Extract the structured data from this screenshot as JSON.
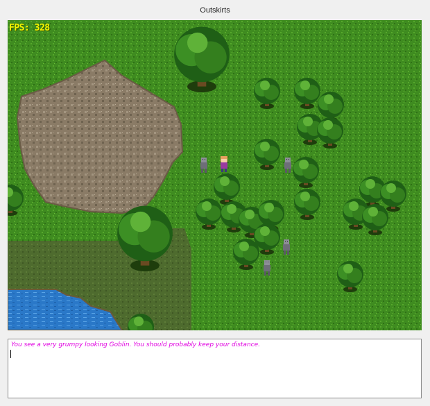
{
  "window": {
    "title": "Outskirts"
  },
  "hud": {
    "fps_label": "FPS: 328"
  },
  "message_log": {
    "lines": [
      "You see a very grumpy looking Goblin.  You should probably keep your distance."
    ]
  },
  "colors": {
    "grass": "#3d8a1f",
    "dirt": "#8b7a63",
    "dark_grass": "#4f6a2e",
    "water": "#2a78c8",
    "fps_text": "#f4f400",
    "message_text": "#e000e0"
  }
}
